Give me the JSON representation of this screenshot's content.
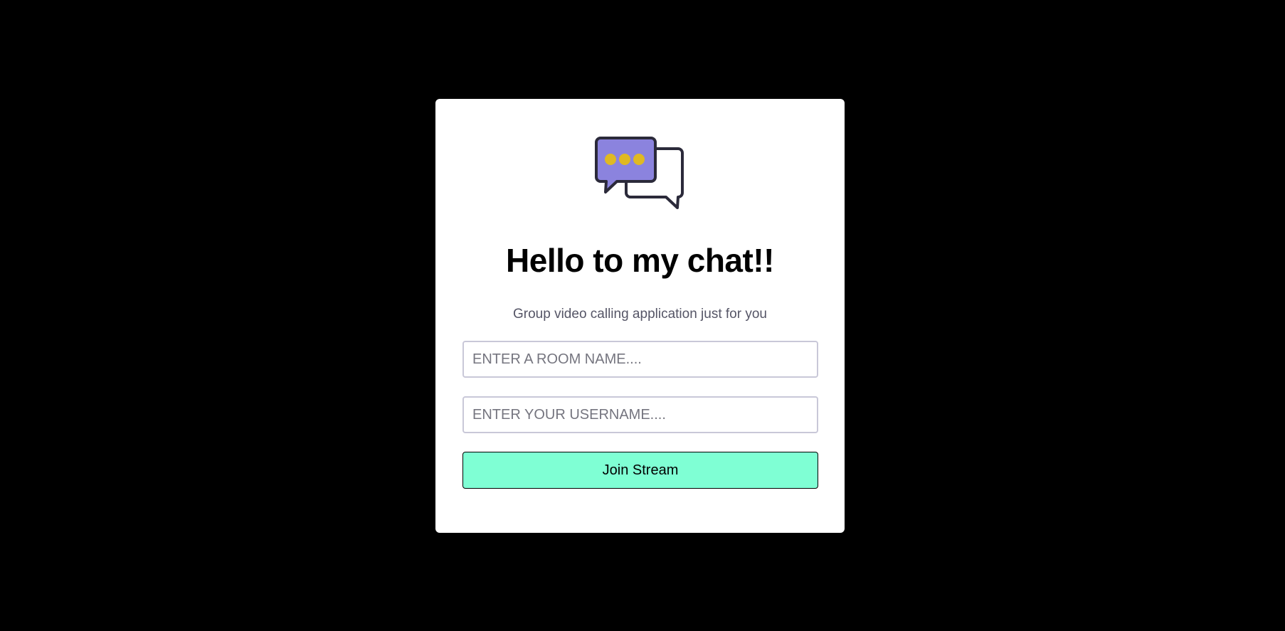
{
  "login": {
    "title": "Hello to my chat!!",
    "subtitle": "Group video calling application just for you",
    "room_input": {
      "value": "",
      "placeholder": "ENTER A ROOM NAME...."
    },
    "username_input": {
      "value": "",
      "placeholder": "ENTER YOUR USERNAME...."
    },
    "join_button_label": "Join Stream"
  },
  "icons": {
    "logo": "chat-bubbles-icon"
  },
  "colors": {
    "background": "#000000",
    "card": "#ffffff",
    "button": "#7fffd4",
    "bubble_fill": "#8b83de",
    "bubble_dots": "#e0b922",
    "bubble_stroke": "#2b2a3a",
    "subtitle": "#555566",
    "input_border": "#c9c8d8"
  }
}
